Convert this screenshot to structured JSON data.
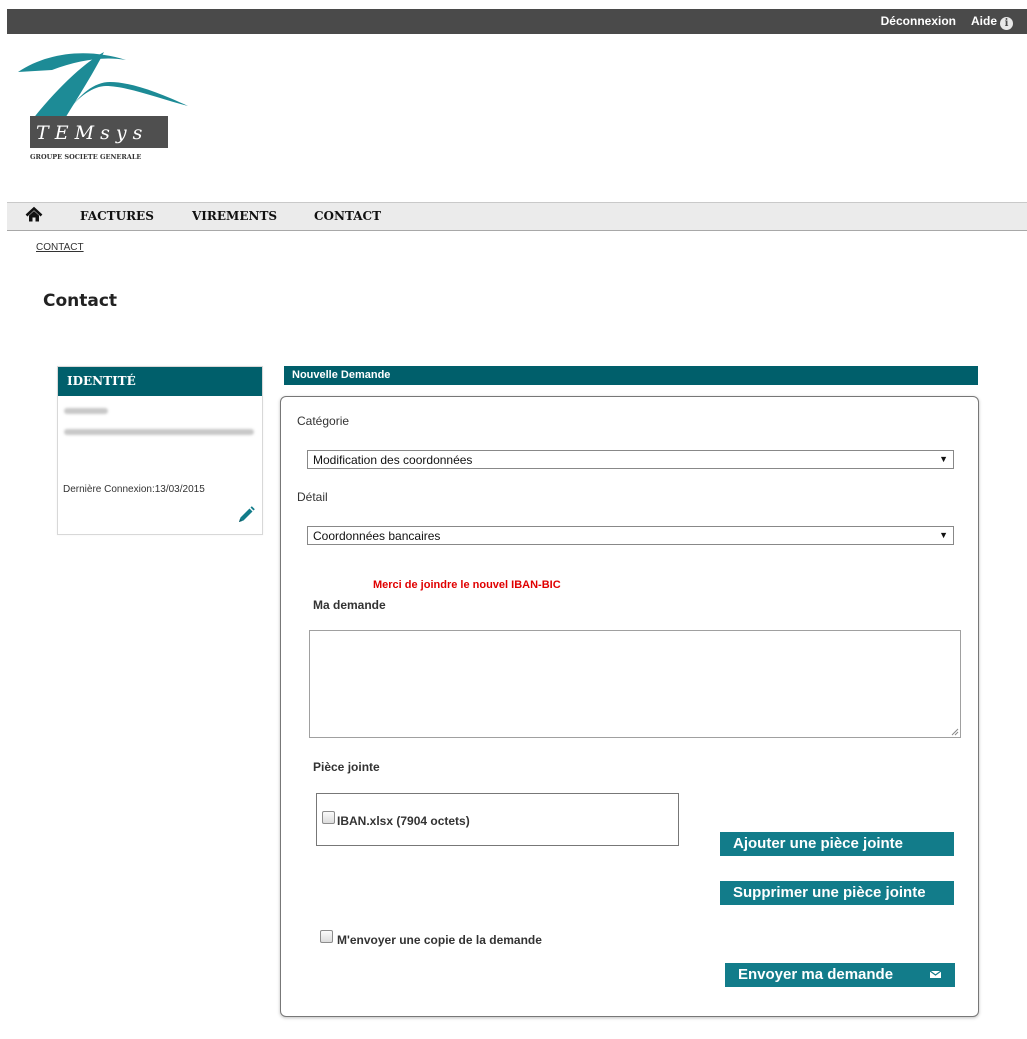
{
  "header": {
    "logout_label": "Déconnexion",
    "help_label": "Aide",
    "help_icon_glyph": "i"
  },
  "logo": {
    "brand": "TEMsys",
    "brand_display": "T E M s y s",
    "group": "GROUPE SOCIETE GENERALE"
  },
  "nav": {
    "home_icon": "home-icon",
    "items": [
      {
        "label": "FACTURES"
      },
      {
        "label": "VIREMENTS"
      },
      {
        "label": "CONTACT"
      }
    ]
  },
  "breadcrumb": "CONTACT",
  "page_title": "Contact",
  "identity": {
    "title": "IDENTITÉ",
    "last_login": "Dernière Connexion:13/03/2015",
    "edit_icon": "pencil-icon"
  },
  "request": {
    "title": "Nouvelle Demande",
    "category_label": "Catégorie",
    "category_value": "Modification des coordonnées",
    "detail_label": "Détail",
    "detail_value": "Coordonnées bancaires",
    "notice": "Merci de joindre le nouvel IBAN-BIC",
    "message_label": "Ma demande",
    "message_value": "",
    "attachment_label": "Pièce jointe",
    "attachments": [
      {
        "label": "IBAN.xlsx  (7904 octets)",
        "checked": false
      }
    ],
    "add_button": "Ajouter une pièce jointe",
    "remove_button": "Supprimer une pièce jointe",
    "copy_label": "M'envoyer une copie de la demande",
    "copy_checked": false,
    "send_button": "Envoyer ma demande",
    "send_icon": "mail-icon"
  },
  "colors": {
    "topbar": "#4a4a4a",
    "teal_header": "#005f6b",
    "button": "#127c8a",
    "notice": "#e00000",
    "logo_teal": "#1d8b96",
    "logo_box": "#4f4f4f"
  }
}
